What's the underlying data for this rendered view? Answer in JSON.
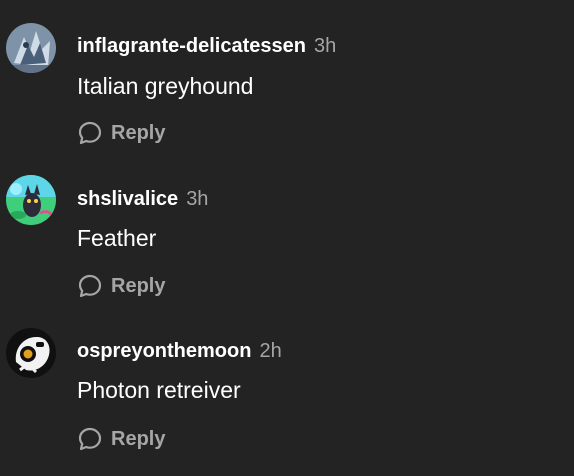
{
  "comments": [
    {
      "username": "inflagrante-delicatessen",
      "time": "3h",
      "text": "Italian greyhound",
      "reply_label": "Reply",
      "colors": {
        "bg": "#8aa0b8",
        "accent": "#4a5f7a",
        "light": "#d7e3ee"
      }
    },
    {
      "username": "shslivalice",
      "time": "3h",
      "text": "Feather",
      "reply_label": "Reply",
      "colors": {
        "bg": "#3fcf7a",
        "accent": "#2b2b3a",
        "light": "#8fe8ff"
      }
    },
    {
      "username": "ospreyonthemoon",
      "time": "2h",
      "text": "Photon retreiver",
      "reply_label": "Reply",
      "colors": {
        "bg": "#111111",
        "accent": "#e0a020",
        "light": "#f2f2f2"
      }
    }
  ],
  "icons": {
    "reply": "speech-bubble-icon"
  }
}
